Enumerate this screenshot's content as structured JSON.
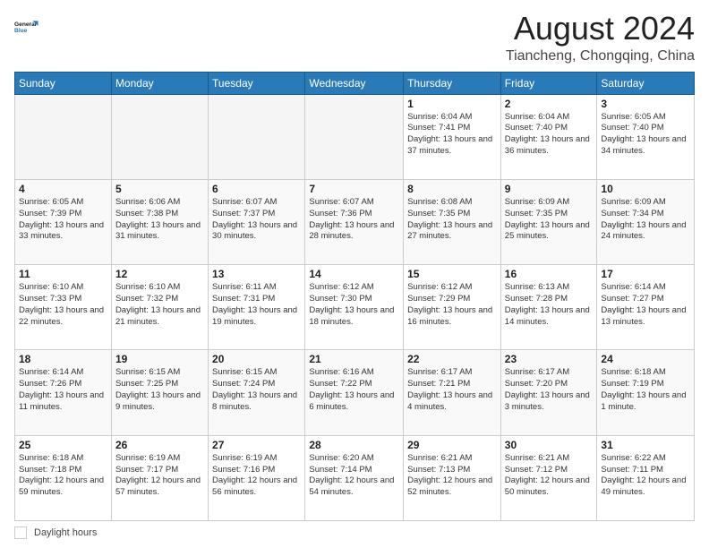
{
  "header": {
    "logo_line1": "General",
    "logo_line2": "Blue",
    "title": "August 2024",
    "subtitle": "Tiancheng, Chongqing, China"
  },
  "days_of_week": [
    "Sunday",
    "Monday",
    "Tuesday",
    "Wednesday",
    "Thursday",
    "Friday",
    "Saturday"
  ],
  "weeks": [
    [
      {
        "day": "",
        "info": ""
      },
      {
        "day": "",
        "info": ""
      },
      {
        "day": "",
        "info": ""
      },
      {
        "day": "",
        "info": ""
      },
      {
        "day": "1",
        "info": "Sunrise: 6:04 AM\nSunset: 7:41 PM\nDaylight: 13 hours\nand 37 minutes."
      },
      {
        "day": "2",
        "info": "Sunrise: 6:04 AM\nSunset: 7:40 PM\nDaylight: 13 hours\nand 36 minutes."
      },
      {
        "day": "3",
        "info": "Sunrise: 6:05 AM\nSunset: 7:40 PM\nDaylight: 13 hours\nand 34 minutes."
      }
    ],
    [
      {
        "day": "4",
        "info": "Sunrise: 6:05 AM\nSunset: 7:39 PM\nDaylight: 13 hours\nand 33 minutes."
      },
      {
        "day": "5",
        "info": "Sunrise: 6:06 AM\nSunset: 7:38 PM\nDaylight: 13 hours\nand 31 minutes."
      },
      {
        "day": "6",
        "info": "Sunrise: 6:07 AM\nSunset: 7:37 PM\nDaylight: 13 hours\nand 30 minutes."
      },
      {
        "day": "7",
        "info": "Sunrise: 6:07 AM\nSunset: 7:36 PM\nDaylight: 13 hours\nand 28 minutes."
      },
      {
        "day": "8",
        "info": "Sunrise: 6:08 AM\nSunset: 7:35 PM\nDaylight: 13 hours\nand 27 minutes."
      },
      {
        "day": "9",
        "info": "Sunrise: 6:09 AM\nSunset: 7:35 PM\nDaylight: 13 hours\nand 25 minutes."
      },
      {
        "day": "10",
        "info": "Sunrise: 6:09 AM\nSunset: 7:34 PM\nDaylight: 13 hours\nand 24 minutes."
      }
    ],
    [
      {
        "day": "11",
        "info": "Sunrise: 6:10 AM\nSunset: 7:33 PM\nDaylight: 13 hours\nand 22 minutes."
      },
      {
        "day": "12",
        "info": "Sunrise: 6:10 AM\nSunset: 7:32 PM\nDaylight: 13 hours\nand 21 minutes."
      },
      {
        "day": "13",
        "info": "Sunrise: 6:11 AM\nSunset: 7:31 PM\nDaylight: 13 hours\nand 19 minutes."
      },
      {
        "day": "14",
        "info": "Sunrise: 6:12 AM\nSunset: 7:30 PM\nDaylight: 13 hours\nand 18 minutes."
      },
      {
        "day": "15",
        "info": "Sunrise: 6:12 AM\nSunset: 7:29 PM\nDaylight: 13 hours\nand 16 minutes."
      },
      {
        "day": "16",
        "info": "Sunrise: 6:13 AM\nSunset: 7:28 PM\nDaylight: 13 hours\nand 14 minutes."
      },
      {
        "day": "17",
        "info": "Sunrise: 6:14 AM\nSunset: 7:27 PM\nDaylight: 13 hours\nand 13 minutes."
      }
    ],
    [
      {
        "day": "18",
        "info": "Sunrise: 6:14 AM\nSunset: 7:26 PM\nDaylight: 13 hours\nand 11 minutes."
      },
      {
        "day": "19",
        "info": "Sunrise: 6:15 AM\nSunset: 7:25 PM\nDaylight: 13 hours\nand 9 minutes."
      },
      {
        "day": "20",
        "info": "Sunrise: 6:15 AM\nSunset: 7:24 PM\nDaylight: 13 hours\nand 8 minutes."
      },
      {
        "day": "21",
        "info": "Sunrise: 6:16 AM\nSunset: 7:22 PM\nDaylight: 13 hours\nand 6 minutes."
      },
      {
        "day": "22",
        "info": "Sunrise: 6:17 AM\nSunset: 7:21 PM\nDaylight: 13 hours\nand 4 minutes."
      },
      {
        "day": "23",
        "info": "Sunrise: 6:17 AM\nSunset: 7:20 PM\nDaylight: 13 hours\nand 3 minutes."
      },
      {
        "day": "24",
        "info": "Sunrise: 6:18 AM\nSunset: 7:19 PM\nDaylight: 13 hours\nand 1 minute."
      }
    ],
    [
      {
        "day": "25",
        "info": "Sunrise: 6:18 AM\nSunset: 7:18 PM\nDaylight: 12 hours\nand 59 minutes."
      },
      {
        "day": "26",
        "info": "Sunrise: 6:19 AM\nSunset: 7:17 PM\nDaylight: 12 hours\nand 57 minutes."
      },
      {
        "day": "27",
        "info": "Sunrise: 6:19 AM\nSunset: 7:16 PM\nDaylight: 12 hours\nand 56 minutes."
      },
      {
        "day": "28",
        "info": "Sunrise: 6:20 AM\nSunset: 7:14 PM\nDaylight: 12 hours\nand 54 minutes."
      },
      {
        "day": "29",
        "info": "Sunrise: 6:21 AM\nSunset: 7:13 PM\nDaylight: 12 hours\nand 52 minutes."
      },
      {
        "day": "30",
        "info": "Sunrise: 6:21 AM\nSunset: 7:12 PM\nDaylight: 12 hours\nand 50 minutes."
      },
      {
        "day": "31",
        "info": "Sunrise: 6:22 AM\nSunset: 7:11 PM\nDaylight: 12 hours\nand 49 minutes."
      }
    ]
  ],
  "footer": {
    "legend_label": "Daylight hours"
  }
}
